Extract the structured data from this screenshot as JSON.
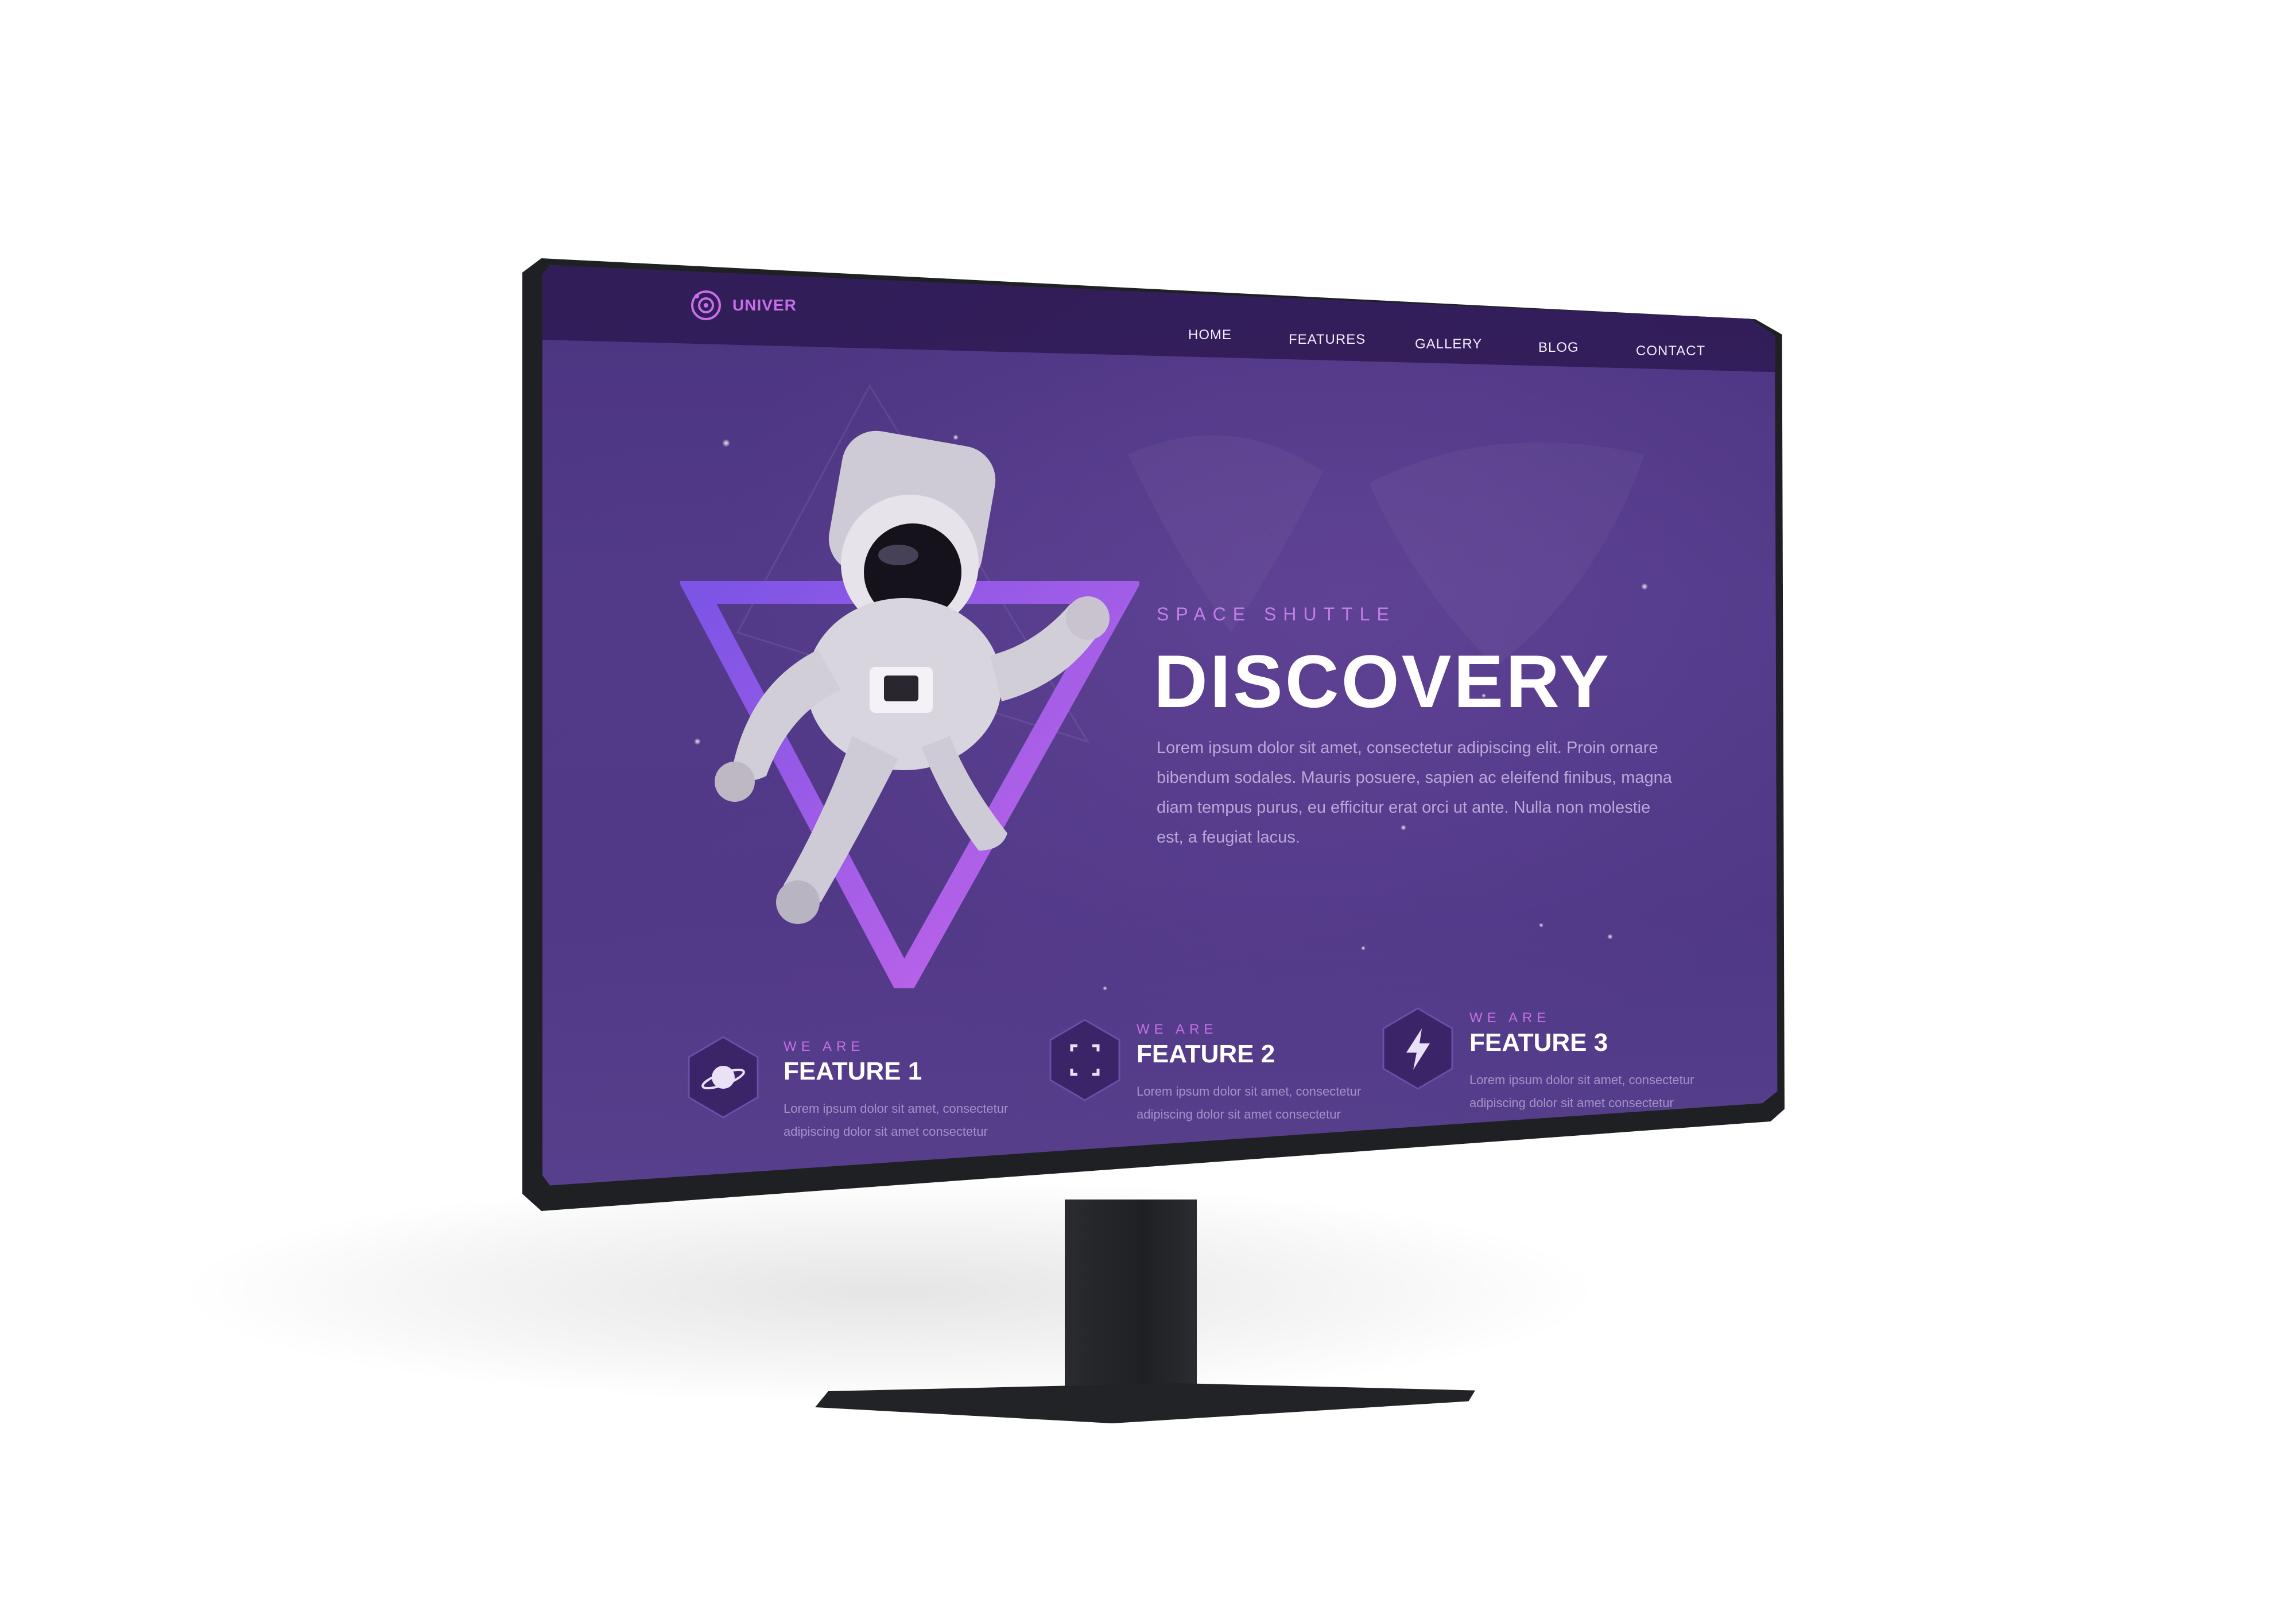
{
  "logo": {
    "text": "UNIVER",
    "icon": "orbit-logo-icon"
  },
  "nav": {
    "items": [
      {
        "label": "HOME"
      },
      {
        "label": "FEATURES"
      },
      {
        "label": "GALLERY"
      },
      {
        "label": "BLOG"
      },
      {
        "label": "CONTACT"
      }
    ]
  },
  "hero": {
    "eyebrow": "SPACE SHUTTLE",
    "title": "DISCOVERY",
    "text": "Lorem ipsum dolor sit amet, consectetur adipiscing elit. Proin ornare bibendum sodales. Mauris posuere, sapien ac eleifend finibus, magna diam tempus purus, eu efficitur erat orci ut ante. Nulla non molestie est, a feugiat lacus."
  },
  "features": [
    {
      "eyebrow": "WE ARE",
      "title": "FEATURE 1",
      "text": "Lorem ipsum dolor sit amet, consectetur adipiscing dolor sit amet consectetur",
      "icon": "planet-icon"
    },
    {
      "eyebrow": "WE ARE",
      "title": "FEATURE 2",
      "text": "Lorem ipsum dolor sit amet, consectetur adipiscing dolor sit amet consectetur",
      "icon": "focus-frame-icon"
    },
    {
      "eyebrow": "WE ARE",
      "title": "FEATURE 3",
      "text": "Lorem ipsum dolor sit amet, consectetur adipiscing dolor sit amet consectetur",
      "icon": "lightning-icon"
    }
  ],
  "colors": {
    "background": "#4f3886",
    "accent": "#c46fe3",
    "triangle_start": "#7c54e6",
    "triangle_end": "#c766e8"
  }
}
